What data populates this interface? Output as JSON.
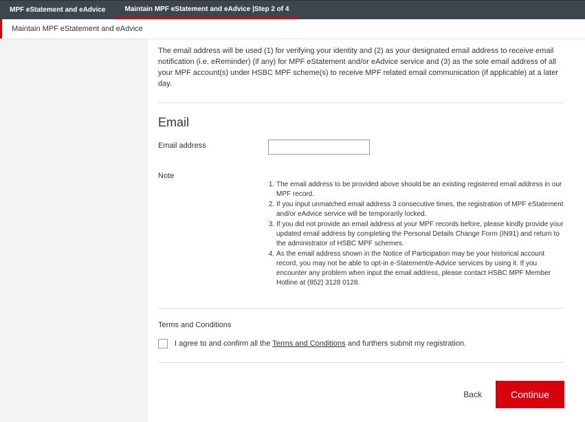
{
  "top_tabs": {
    "tab1": "MPF eStatement and eAdvice",
    "tab2": "Maintain MPF eStatement and eAdvice |Step 2 of 4"
  },
  "sub_tab": "Maintain MPF eStatement and eAdvice",
  "intro": "The email address will be used (1) for verifying your identity and (2) as your designated email address to receive email notification (i.e. eReminder) (if any) for MPF eStatement and/or eAdvice service and (3) as the sole email address of all your MPF account(s) under HSBC MPF scheme(s) to receive MPF related email communication (if applicable) at a later day.",
  "email": {
    "heading": "Email",
    "label": "Email address",
    "value": ""
  },
  "note": {
    "label": "Note",
    "items": [
      "The email address to be provided above should be an existing registered email address in our MPF record.",
      "If you input unmatched email address 3 consecutive times, the registration of MPF eStatement and/or eAdvice service will be temporarily locked.",
      "If you did not provide an email address at your MPF records before, please kindly provide your updated email address by completing the Personal Details Change Form (IN91) and return to the administrator of HSBC MPF schemes.",
      "As the email address shown in the Notice of Participation may be your historical account record, you may not be able to opt-in e-Statement/e-Advice services by using it. If you encounter any problem when input the email address, please contact HSBC MPF Member Hotline at (852) 3128 0128."
    ]
  },
  "terms": {
    "heading": "Terms and Conditions",
    "prefix": "I agree to and confirm all the ",
    "link": "Terms and Conditions",
    "suffix": " and furthers submit my registration."
  },
  "actions": {
    "back": "Back",
    "continue": "Continue"
  }
}
